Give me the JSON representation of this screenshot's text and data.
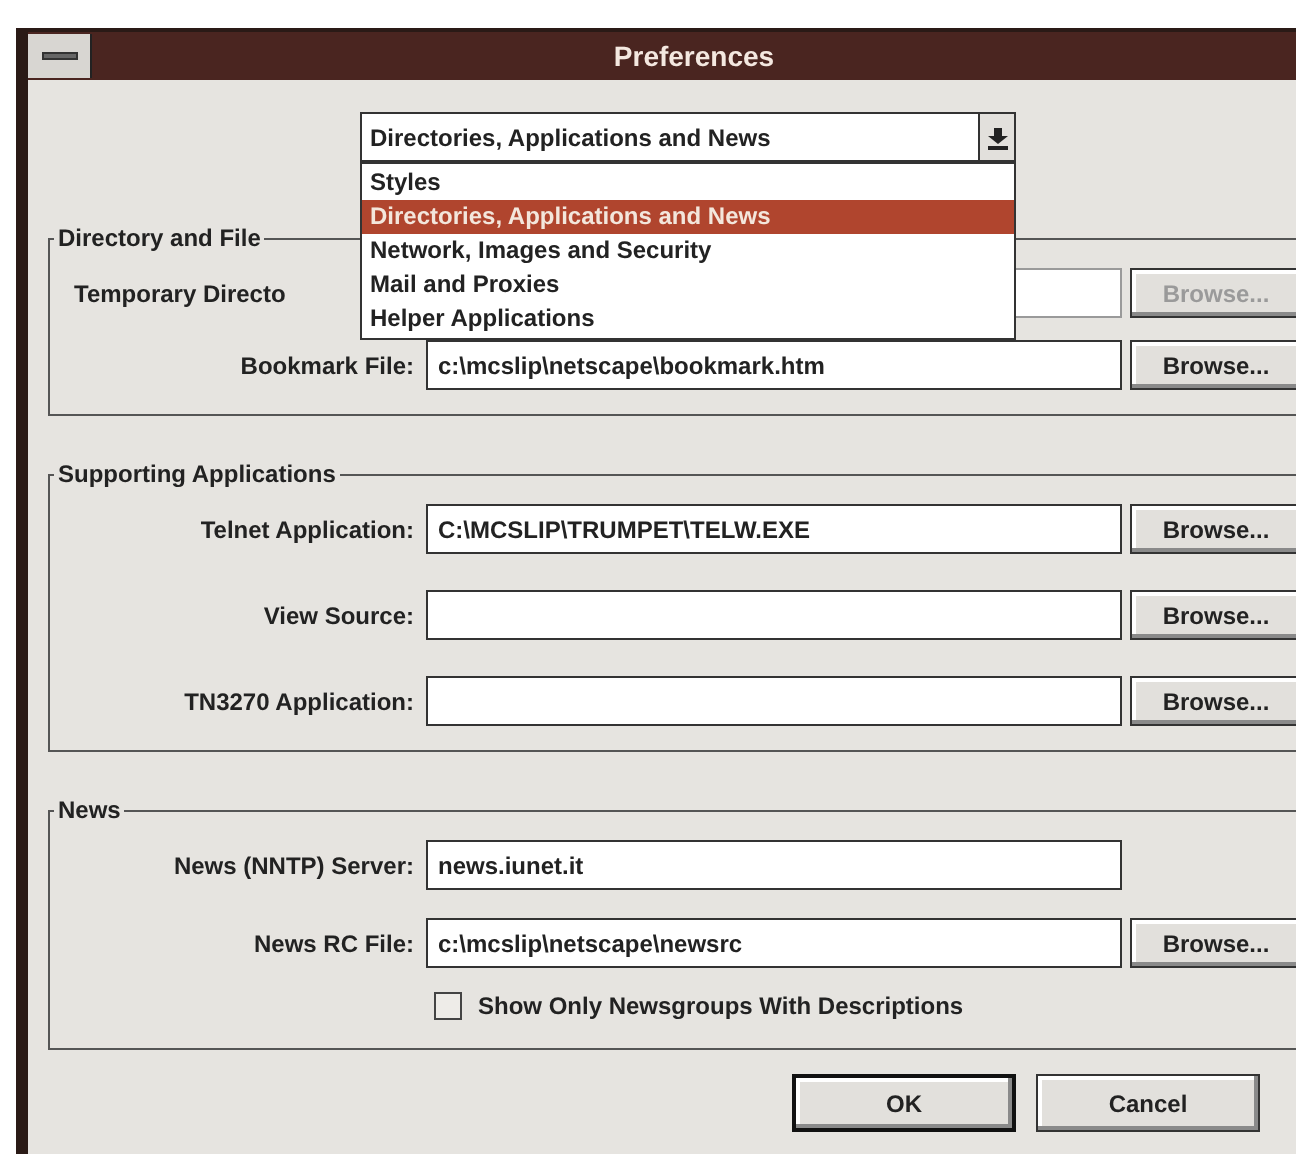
{
  "window": {
    "title": "Preferences"
  },
  "category_dropdown": {
    "value": "Directories, Applications and News",
    "expanded": true,
    "options": [
      {
        "label": "Styles",
        "selected": false
      },
      {
        "label": "Directories, Applications and News",
        "selected": true
      },
      {
        "label": "Network, Images and Security",
        "selected": false
      },
      {
        "label": "Mail and Proxies",
        "selected": false
      },
      {
        "label": "Helper Applications",
        "selected": false
      }
    ]
  },
  "groups": [
    {
      "title": "Directory and File",
      "rows": [
        {
          "label": "Temporary Directo",
          "disabled": true,
          "browse": "Browse..."
        },
        {
          "label": "Bookmark File:",
          "value": "c:\\mcslip\\netscape\\bookmark.htm",
          "disabled": false,
          "browse": "Browse..."
        }
      ]
    },
    {
      "title": "Supporting Applications",
      "rows": [
        {
          "label": "Telnet Application:",
          "value": "C:\\MCSLIP\\TRUMPET\\TELW.EXE",
          "disabled": false,
          "browse": "Browse..."
        },
        {
          "label": "View Source:",
          "disabled": false,
          "browse": "Browse..."
        },
        {
          "label": "TN3270 Application:",
          "disabled": false,
          "browse": "Browse..."
        }
      ]
    },
    {
      "title": "News",
      "rows": [
        {
          "label": "News (NNTP) Server:",
          "value": "news.iunet.it",
          "disabled": false
        },
        {
          "label": "News RC File:",
          "value": "c:\\mcslip\\netscape\\newsrc",
          "disabled": false,
          "browse": "Browse..."
        }
      ],
      "checkbox": {
        "label": "Show Only Newsgroups With Descriptions",
        "checked": false
      }
    }
  ],
  "buttons": [
    {
      "label": "OK",
      "default": true
    },
    {
      "label": "Cancel",
      "default": false
    }
  ]
}
